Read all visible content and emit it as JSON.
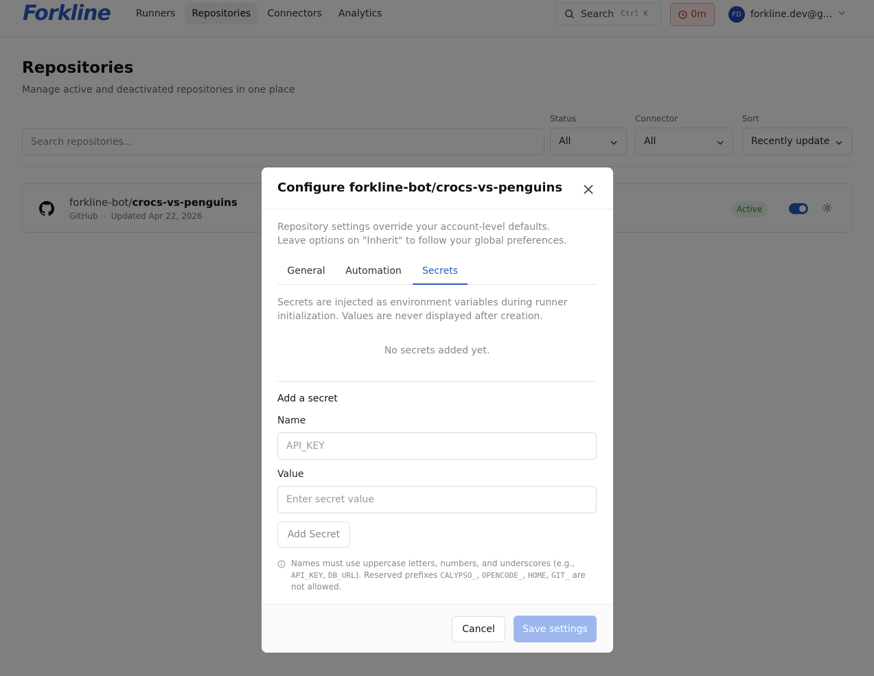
{
  "header": {
    "logo": "Forkline",
    "nav": [
      "Runners",
      "Repositories",
      "Connectors",
      "Analytics"
    ],
    "active_nav": "Repositories",
    "search_label": "Search",
    "search_shortcut": "Ctrl K",
    "timer": "0m",
    "user_initials": "FD",
    "user_email": "forkline.dev@g..."
  },
  "page": {
    "title": "Repositories",
    "subtitle": "Manage active and deactivated repositories in one place",
    "search_placeholder": "Search repositories...",
    "filters": {
      "status_label": "Status",
      "status_value": "All",
      "connector_label": "Connector",
      "connector_value": "All",
      "sort_label": "Sort",
      "sort_value": "Recently update"
    }
  },
  "repo": {
    "owner": "forkline-bot/",
    "name": "crocs-vs-penguins",
    "provider": "GitHub",
    "separator": "·",
    "updated": "Updated Apr 22, 2026",
    "status": "Active",
    "enabled": true
  },
  "modal": {
    "title": "Configure forkline-bot/crocs-vs-penguins",
    "description": "Repository settings override your account-level defaults. Leave options on \"Inherit\" to follow your global preferences.",
    "tabs": [
      "General",
      "Automation",
      "Secrets"
    ],
    "active_tab": "Secrets",
    "secrets_description": "Secrets are injected as environment variables during runner initialization. Values are never displayed after creation.",
    "empty_message": "No secrets added yet.",
    "add_title": "Add a secret",
    "name_label": "Name",
    "name_placeholder": "API_KEY",
    "value_label": "Value",
    "value_placeholder": "Enter secret value",
    "add_button": "Add Secret",
    "hint": {
      "part1": "Names must use uppercase letters, numbers, and underscores (e.g., ",
      "ex1": "API_KEY",
      "part2": ", ",
      "ex2": "DB_URL",
      "part3": "). Reserved prefixes ",
      "p1": "CALYPSO_",
      "part4": ", ",
      "p2": "OPENCODE_",
      "part5": ", ",
      "p3": "HOME",
      "part6": ", ",
      "p4": "GIT_",
      "part7": " are not allowed."
    },
    "cancel_button": "Cancel",
    "save_button": "Save settings"
  },
  "colors": {
    "brand": "#2a5cc0",
    "overlay": "rgba(0,0,0,0.5)",
    "active_badge_bg": "#e4f4e7",
    "timer_bg": "#fdeaea",
    "save_disabled": "#9db6ec"
  }
}
